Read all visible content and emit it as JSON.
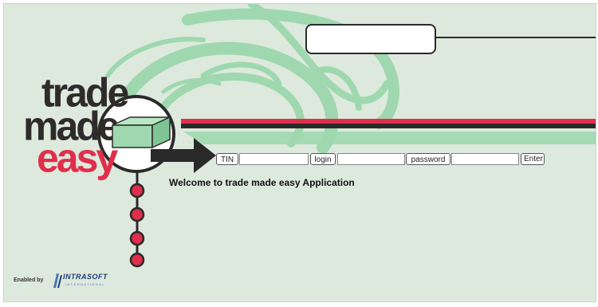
{
  "logo": {
    "line1": "trade",
    "line2": "made",
    "line3": "easy"
  },
  "login_bar": {
    "tin_label": "TIN",
    "tin_value": "",
    "login_label": "login",
    "login_value": "",
    "password_label": "password",
    "password_value": "",
    "enter_label": "Enter"
  },
  "welcome": "Welcome to trade made easy Application",
  "footer": {
    "enabled_by": "Enabled by",
    "brand": "INTRASOFT",
    "brand_sub": "INTERNATIONAL"
  },
  "colors": {
    "background": "#dde9dd",
    "swirl": "#9fd8ae",
    "accent_red": "#e02f4c",
    "dark": "#2a2a2a"
  },
  "icons": [
    "box-icon",
    "arrow-right-icon",
    "chain-dot-icon",
    "intrasoft-logo-icon"
  ]
}
